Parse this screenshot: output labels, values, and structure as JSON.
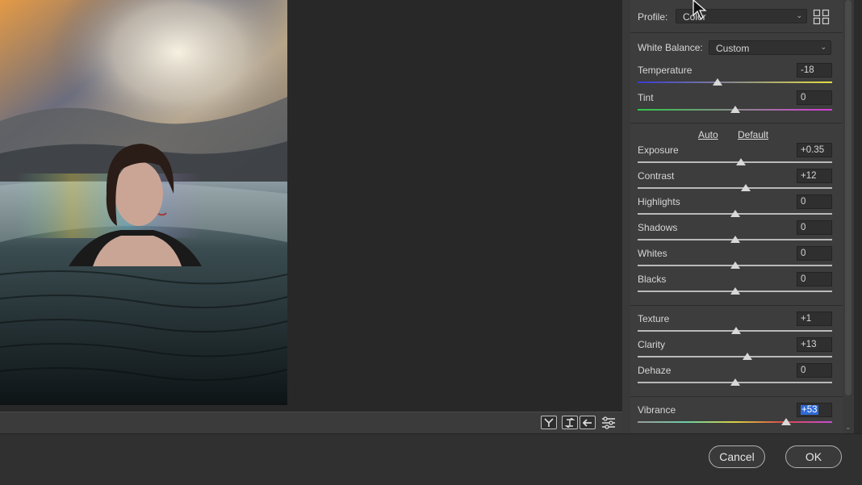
{
  "profile": {
    "label": "Profile:",
    "value": "Color"
  },
  "white_balance": {
    "label": "White Balance:",
    "value": "Custom"
  },
  "basic_links": {
    "auto": "Auto",
    "default": "Default"
  },
  "sliders": [
    {
      "label": "Temperature",
      "value": "-18",
      "position": 0.41
    },
    {
      "label": "Tint",
      "value": "0",
      "position": 0.5
    },
    {
      "label": "Exposure",
      "value": "+0.35",
      "position": 0.53
    },
    {
      "label": "Contrast",
      "value": "+12",
      "position": 0.555
    },
    {
      "label": "Highlights",
      "value": "0",
      "position": 0.5
    },
    {
      "label": "Shadows",
      "value": "0",
      "position": 0.5
    },
    {
      "label": "Whites",
      "value": "0",
      "position": 0.5
    },
    {
      "label": "Blacks",
      "value": "0",
      "position": 0.5
    },
    {
      "label": "Texture",
      "value": "+1",
      "position": 0.505
    },
    {
      "label": "Clarity",
      "value": "+13",
      "position": 0.565
    },
    {
      "label": "Dehaze",
      "value": "0",
      "position": 0.5
    },
    {
      "label": "Vibrance",
      "value": "+53",
      "position": 0.765
    }
  ],
  "footer": {
    "cancel": "Cancel",
    "ok": "OK"
  },
  "icons": {
    "browse": "profile-browser-grid-icon",
    "before_after": "before-after-toggle-icon",
    "swap": "swap-settings-icon",
    "copy": "copy-settings-icon",
    "prefs": "preferences-sliders-icon"
  },
  "colors": {
    "panel_bg": "#3d3d3d",
    "selected_value": "#2e6bd6"
  }
}
